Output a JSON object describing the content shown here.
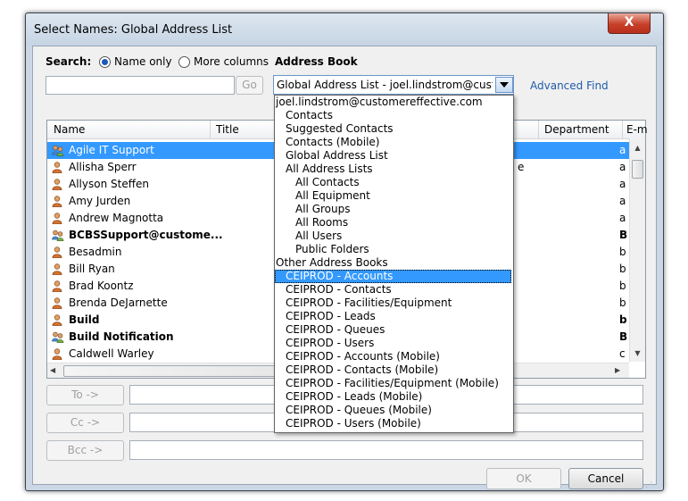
{
  "window": {
    "title": "Select Names: Global Address List",
    "close_glyph": "X"
  },
  "search": {
    "label": "Search:",
    "option_name_only": "Name only",
    "option_more_columns": "More columns",
    "input_value": "",
    "go_label": "Go"
  },
  "address_book": {
    "label": "Address Book",
    "selected": "Global Address List - joel.lindstrom@customereffective.com",
    "advanced_find": "Advanced Find",
    "dropdown_items": [
      {
        "label": "joel.lindstrom@customereffective.com",
        "indent": 0
      },
      {
        "label": "Contacts",
        "indent": 1
      },
      {
        "label": "Suggested Contacts",
        "indent": 1
      },
      {
        "label": "Contacts (Mobile)",
        "indent": 1
      },
      {
        "label": "Global Address List",
        "indent": 1
      },
      {
        "label": "All Address Lists",
        "indent": 1
      },
      {
        "label": "All Contacts",
        "indent": 2
      },
      {
        "label": "All Equipment",
        "indent": 2
      },
      {
        "label": "All Groups",
        "indent": 2
      },
      {
        "label": "All Rooms",
        "indent": 2
      },
      {
        "label": "All Users",
        "indent": 2
      },
      {
        "label": "Public Folders",
        "indent": 2
      },
      {
        "label": "Other Address Books",
        "indent": 0
      },
      {
        "label": "CEIPROD - Accounts",
        "indent": 1,
        "selected": true
      },
      {
        "label": "CEIPROD - Contacts",
        "indent": 1
      },
      {
        "label": "CEIPROD - Facilities/Equipment",
        "indent": 1
      },
      {
        "label": "CEIPROD - Leads",
        "indent": 1
      },
      {
        "label": "CEIPROD - Queues",
        "indent": 1
      },
      {
        "label": "CEIPROD - Users",
        "indent": 1
      },
      {
        "label": "CEIPROD - Accounts (Mobile)",
        "indent": 1
      },
      {
        "label": "CEIPROD - Contacts (Mobile)",
        "indent": 1
      },
      {
        "label": "CEIPROD - Facilities/Equipment (Mobile)",
        "indent": 1
      },
      {
        "label": "CEIPROD - Leads (Mobile)",
        "indent": 1
      },
      {
        "label": "CEIPROD - Queues (Mobile)",
        "indent": 1
      },
      {
        "label": "CEIPROD - Users (Mobile)",
        "indent": 1
      }
    ]
  },
  "grid": {
    "columns": [
      "Name",
      "Title",
      "Department",
      "E-m"
    ],
    "rows": [
      {
        "name": "Agile IT Support",
        "icon": "group-icon",
        "bold": false,
        "selected": true,
        "trail": "a",
        "mid": ""
      },
      {
        "name": "Allisha Sperr",
        "icon": "person-icon",
        "bold": false,
        "trail": "a",
        "mid": "e"
      },
      {
        "name": "Allyson Steffen",
        "icon": "person-icon",
        "bold": false,
        "trail": "a",
        "mid": ""
      },
      {
        "name": "Amy Jurden",
        "icon": "person-icon",
        "bold": false,
        "trail": "a",
        "mid": ""
      },
      {
        "name": "Andrew Magnotta",
        "icon": "person-icon",
        "bold": false,
        "trail": "a",
        "mid": ""
      },
      {
        "name": "BCBSSupport@custome...",
        "icon": "group-icon",
        "bold": true,
        "trail": "B",
        "mid": ""
      },
      {
        "name": "Besadmin",
        "icon": "person-icon",
        "bold": false,
        "trail": "b",
        "mid": ""
      },
      {
        "name": "Bill Ryan",
        "icon": "person-icon",
        "bold": false,
        "trail": "b",
        "mid": ""
      },
      {
        "name": "Brad Koontz",
        "icon": "person-icon",
        "bold": false,
        "trail": "b",
        "mid": ""
      },
      {
        "name": "Brenda DeJarnette",
        "icon": "person-icon",
        "bold": false,
        "trail": "b",
        "mid": ""
      },
      {
        "name": "Build",
        "icon": "person-icon",
        "bold": true,
        "trail": "b",
        "mid": ""
      },
      {
        "name": "Build Notification",
        "icon": "group-icon",
        "bold": true,
        "trail": "B",
        "mid": ""
      },
      {
        "name": "Caldwell Warley",
        "icon": "person-icon",
        "bold": false,
        "trail": "c",
        "mid": ""
      }
    ]
  },
  "recipients": {
    "to_label": "To ->",
    "cc_label": "Cc ->",
    "bcc_label": "Bcc ->"
  },
  "footer": {
    "ok_label": "OK",
    "cancel_label": "Cancel"
  },
  "colors": {
    "selection": "#3399ff",
    "link": "#1f5aa8",
    "close": "#c7402a"
  }
}
